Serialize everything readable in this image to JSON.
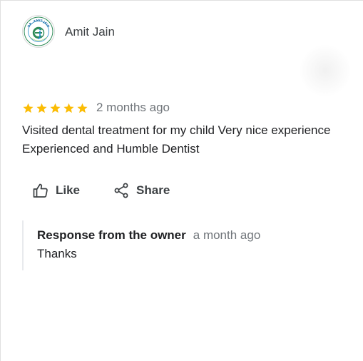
{
  "review": {
    "author_name": "Amit Jain",
    "avatar_icon": "clinic-logo-icon",
    "avatar_logo_text": "DR. AMIT JAIN",
    "rating": 5,
    "rating_max": 5,
    "time": "2 months ago",
    "text": "Visited dental treatment for my child Very nice experience Experienced and Humble Dentist"
  },
  "actions": {
    "like_label": "Like",
    "like_icon": "thumbs-up-icon",
    "share_label": "Share",
    "share_icon": "share-icon"
  },
  "owner_response": {
    "title": "Response from the owner",
    "time": "a month ago",
    "text": "Thanks"
  },
  "colors": {
    "star": "#fbbc04",
    "text": "#202124",
    "muted": "#70757a",
    "logo_green": "#2e8b57",
    "logo_blue": "#1e88c8"
  }
}
